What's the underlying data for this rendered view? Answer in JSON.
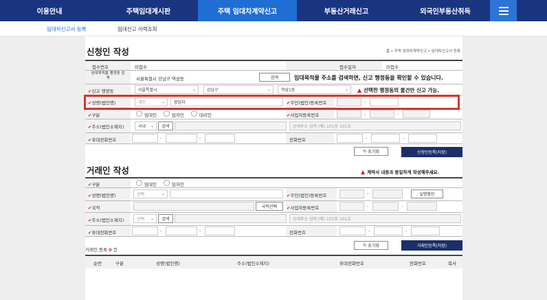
{
  "topnav": {
    "items": [
      "이용안내",
      "주택임대계시판",
      "주택 임대차계약신고",
      "부동산거래신고",
      "외국인부동산취득"
    ],
    "active_index": 2
  },
  "subnav": {
    "items": [
      "임대차신고서 등록",
      "임대신고 이력조회"
    ]
  },
  "applicant": {
    "title": "신청인 작성",
    "breadcrumb": "홈 • 주택 임대차계약신고 • 임대차신고서 등록",
    "receipt_no_label": "접수번호",
    "receipt_no_value": "미접수",
    "receipt_date_label": "접수일자",
    "receipt_date_value": "미접수",
    "search_addr_label": "임대목적물 행정동 검색",
    "search_addr_value": "서울특별시 강남구 역삼동",
    "search_btn": "검색",
    "search_hint": "임대목적물 주소를 검색하면, 신고 행정동을 확인할 수 있습니다.",
    "district_label": "신고 행정동",
    "district_sido": "서울특별시",
    "district_sgg": "강남구",
    "district_dong": "역삼1동",
    "district_warning": "선택한 행정동의 물건만 신고 가능.",
    "name_label": "성명(법인명)",
    "name_type": "개인",
    "name_value": "장임차",
    "id_label": "주민(법인)등록번호",
    "type_label": "구분",
    "type_options": [
      "임대인",
      "임차인",
      "대리인"
    ],
    "biz_label": "사업자등록번호",
    "address_label": "주소(법인소재지)",
    "address_country": "국내",
    "address_search_btn": "검색",
    "address_detail_placeholder": "상세주소 입력 (예) 101동 101호",
    "mobile_label": "휴대전화번호",
    "phone_label": "전화번호",
    "reset_btn": "초기화",
    "register_btn": "신청인등록(저장)"
  },
  "counterparty": {
    "title": "거래인 작성",
    "warning": "계약서 내용과 동일하게 작성해주세요.",
    "type_label": "구분",
    "type_options": [
      "임대인",
      "임차인"
    ],
    "name_label": "성명(법인명)",
    "name_type": "선택",
    "id_label": "주민(법인)등록번호",
    "verify_btn": "실명확인",
    "nationality_label": "국적",
    "nationality_btn": "국적선택",
    "biz_label": "사업자등록번호",
    "address_label": "주소(법인소재지)",
    "address_country": "선택",
    "address_search_btn": "검색",
    "address_detail_placeholder": "상세주소 입력 (예) 101동 101호",
    "mobile_label": "휴대전화번호",
    "phone_label": "전화번호",
    "count_label": "거래인 등록",
    "count_value": "0",
    "count_unit": "건",
    "reset_btn": "초기화",
    "register_btn": "거래인등록(저장)"
  },
  "table": {
    "headers": [
      "순번",
      "구분",
      "성명(법인명)",
      "주소(법인소재지)",
      "휴대전화번호",
      "전화번호",
      "복사"
    ]
  }
}
